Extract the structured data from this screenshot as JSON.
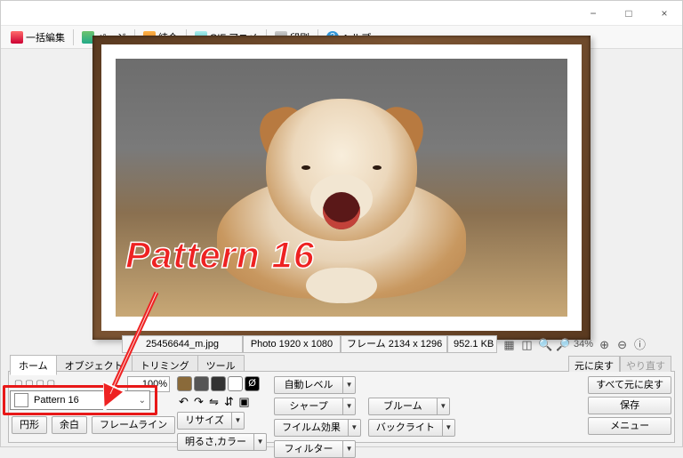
{
  "window": {
    "minimize": "−",
    "maximize": "□",
    "close": "×"
  },
  "toolbar": {
    "batch_edit": "一括編集",
    "page": "ページ",
    "combine": "結合",
    "gif_anime": "GIF アニメ",
    "print": "印刷",
    "help": "ヘルプ"
  },
  "annotation": {
    "text": "Pattern 16"
  },
  "status": {
    "filename": "25456644_m.jpg",
    "photo_dim": "Photo 1920 x 1080",
    "frame_dim": "フレーム 2134 x 1296",
    "filesize": "952.1 KB",
    "zoom": "34%"
  },
  "tabs": {
    "home": "ホーム",
    "object": "オブジェクト",
    "trimming": "トリミング",
    "tool": "ツール"
  },
  "panel": {
    "percent": "100%",
    "auto_level": "自動レベル",
    "sharpen": "シャープ",
    "bloom": "ブルーム",
    "resize": "リサイズ",
    "film_effect": "フイルム効果",
    "backlight": "バックライト",
    "brightness_color": "明るさ,カラー",
    "filter": "フィルター",
    "bottom1": "円形",
    "bottom2": "余白",
    "bottom3": "フレームライン"
  },
  "pattern": {
    "selected": "Pattern 16"
  },
  "right": {
    "undo": "元に戻す",
    "redo": "やり直す",
    "undo_all": "すべて元に戻す",
    "save": "保存",
    "menu": "メニュー"
  }
}
